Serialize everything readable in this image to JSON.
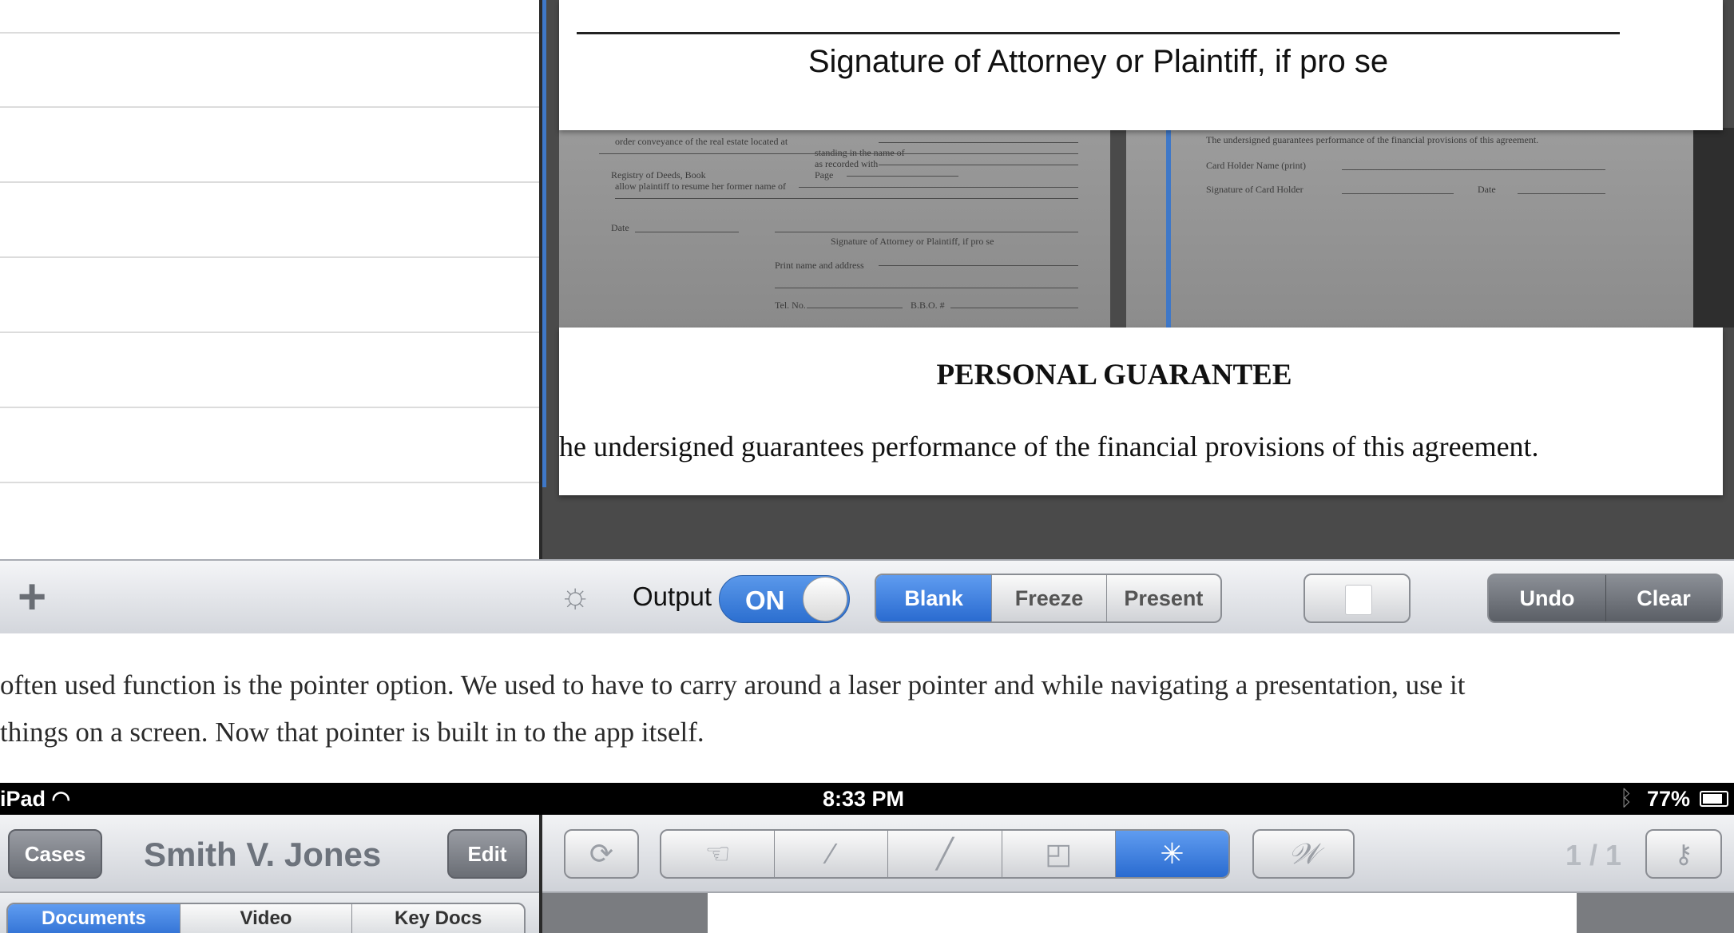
{
  "top_screenshot": {
    "signature_label": "Signature of Attorney or Plaintiff, if pro se",
    "thumb_left_lines": [
      "order conveyance of the real estate located at",
      "standing in the name of",
      "as recorded with",
      "Registry of Deeds, Book",
      "Page",
      "allow plaintiff to resume her former name of",
      "Date",
      "Signature of Attorney or Plaintiff, if pro se",
      "Print name and address",
      "Tel. No.",
      "B.B.O. #"
    ],
    "thumb_right_lines": [
      "The undersigned guarantees performance of the financial provisions of this agreement.",
      "Card Holder Name (print)",
      "Signature of Card Holder",
      "Date"
    ],
    "guarantee_title": "PERSONAL GUARANTEE",
    "guarantee_body": "he undersigned guarantees performance of the financial provisions of this agreement.",
    "toolbar": {
      "add_icon": "plus-icon",
      "settings_icon": "sun-icon",
      "output_label": "Output",
      "toggle_label": "ON",
      "modes": [
        "Blank",
        "Freeze",
        "Present"
      ],
      "active_mode": "Blank",
      "undo_label": "Undo",
      "clear_label": "Clear"
    },
    "accent_color": "#2a6bd0"
  },
  "prose": {
    "line1": " often used function is the pointer option.  We used to have to carry around a  laser pointer and while navigating a presentation, use it",
    "line2": "things on a screen.  Now that pointer is built in to the app itself."
  },
  "bottom_screenshot": {
    "status": {
      "device": "iPad",
      "time": "8:33 PM",
      "battery": "77%"
    },
    "nav": {
      "cases_label": "Cases",
      "case_title": "Smith V. Jones",
      "edit_label": "Edit",
      "refresh_icon": "refresh-icon",
      "tools": [
        "hand-pointer-icon",
        "highlighter-icon",
        "pen-icon",
        "callout-icon",
        "laser-pointer-icon"
      ],
      "active_tool": "laser-pointer-icon",
      "signature_icon": "signature-icon",
      "page_count": "1 / 1",
      "key_icon": "key-icon"
    },
    "tabs": [
      "Documents",
      "Video",
      "Key Docs"
    ],
    "active_tab": "Documents"
  }
}
